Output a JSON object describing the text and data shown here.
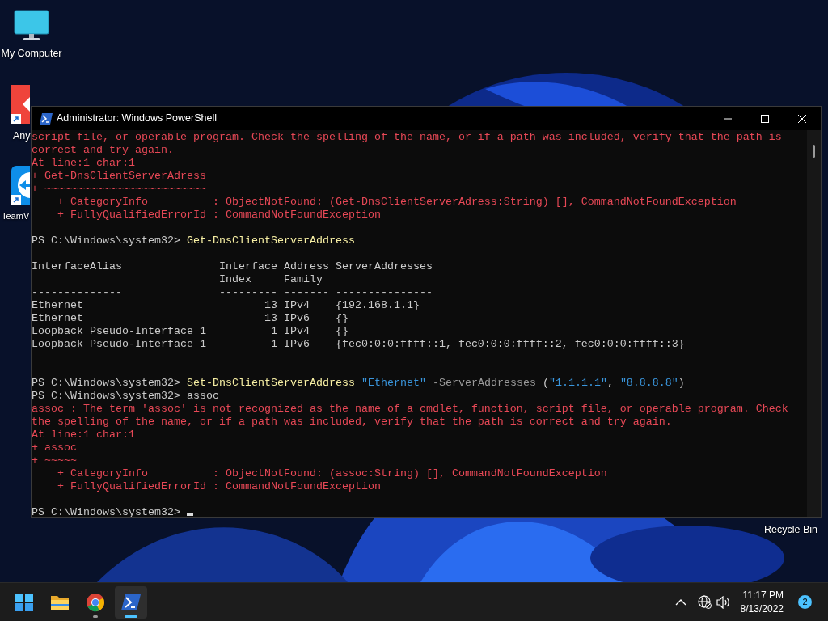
{
  "desktop_icons": [
    {
      "label": "My Computer",
      "kind": "computer",
      "shortcut": false
    },
    {
      "label": "Any",
      "kind": "anydesk",
      "shortcut": true
    },
    {
      "label": "TeamV",
      "kind": "teamviewer",
      "shortcut": true
    }
  ],
  "recycle_bin": {
    "label": "Recycle Bin"
  },
  "window": {
    "title": "Administrator: Windows PowerShell",
    "lines": [
      {
        "kind": "text",
        "segments": [
          {
            "kind": "error",
            "text": "script file, or operable program. Check the spelling of the name, or if a path was included, verify that the path is"
          }
        ]
      },
      {
        "kind": "text",
        "segments": [
          {
            "kind": "error",
            "text": "correct and try again."
          }
        ]
      },
      {
        "kind": "text",
        "segments": [
          {
            "kind": "error",
            "text": "At line:1 char:1"
          }
        ]
      },
      {
        "kind": "text",
        "segments": [
          {
            "kind": "error",
            "text": "+ Get-DnsClientServerAdress"
          }
        ]
      },
      {
        "kind": "text",
        "segments": [
          {
            "kind": "error",
            "text": "+ ~~~~~~~~~~~~~~~~~~~~~~~~~"
          }
        ]
      },
      {
        "kind": "text",
        "segments": [
          {
            "kind": "error",
            "text": "    + CategoryInfo          : ObjectNotFound: (Get-DnsClientServerAdress:String) [], CommandNotFoundException"
          }
        ]
      },
      {
        "kind": "text",
        "segments": [
          {
            "kind": "error",
            "text": "    + FullyQualifiedErrorId : CommandNotFoundException"
          }
        ]
      },
      {
        "kind": "blank"
      },
      {
        "kind": "text",
        "segments": [
          {
            "kind": "prompt",
            "text": "PS C:\\Windows\\system32> "
          },
          {
            "kind": "command",
            "text": "Get-DnsClientServerAddress"
          }
        ]
      },
      {
        "kind": "blank"
      },
      {
        "kind": "text",
        "segments": [
          {
            "kind": "output",
            "text": "InterfaceAlias               Interface Address ServerAddresses"
          }
        ]
      },
      {
        "kind": "text",
        "segments": [
          {
            "kind": "output",
            "text": "                             Index     Family"
          }
        ]
      },
      {
        "kind": "text",
        "segments": [
          {
            "kind": "output",
            "text": "--------------               --------- ------- ---------------"
          }
        ]
      },
      {
        "kind": "text",
        "segments": [
          {
            "kind": "output",
            "text": "Ethernet                            13 IPv4    {192.168.1.1}"
          }
        ]
      },
      {
        "kind": "text",
        "segments": [
          {
            "kind": "output",
            "text": "Ethernet                            13 IPv6    {}"
          }
        ]
      },
      {
        "kind": "text",
        "segments": [
          {
            "kind": "output",
            "text": "Loopback Pseudo-Interface 1          1 IPv4    {}"
          }
        ]
      },
      {
        "kind": "text",
        "segments": [
          {
            "kind": "output",
            "text": "Loopback Pseudo-Interface 1          1 IPv6    {fec0:0:0:ffff::1, fec0:0:0:ffff::2, fec0:0:0:ffff::3}"
          }
        ]
      },
      {
        "kind": "blank"
      },
      {
        "kind": "blank"
      },
      {
        "kind": "text",
        "segments": [
          {
            "kind": "prompt",
            "text": "PS C:\\Windows\\system32> "
          },
          {
            "kind": "command",
            "text": "Set-DnsClientServerAddress"
          },
          {
            "kind": "string",
            "text": " \"Ethernet\""
          },
          {
            "kind": "parameter",
            "text": " -ServerAddresses"
          },
          {
            "kind": "output",
            "text": " ("
          },
          {
            "kind": "string",
            "text": "\"1.1.1.1\""
          },
          {
            "kind": "output",
            "text": ", "
          },
          {
            "kind": "string",
            "text": "\"8.8.8.8\""
          },
          {
            "kind": "output",
            "text": ")"
          }
        ]
      },
      {
        "kind": "text",
        "segments": [
          {
            "kind": "prompt",
            "text": "PS C:\\Windows\\system32> "
          },
          {
            "kind": "output",
            "text": "assoc"
          }
        ]
      },
      {
        "kind": "text",
        "segments": [
          {
            "kind": "error",
            "text": "assoc : The term 'assoc' is not recognized as the name of a cmdlet, function, script file, or operable program. Check"
          }
        ]
      },
      {
        "kind": "text",
        "segments": [
          {
            "kind": "error",
            "text": "the spelling of the name, or if a path was included, verify that the path is correct and try again."
          }
        ]
      },
      {
        "kind": "text",
        "segments": [
          {
            "kind": "error",
            "text": "At line:1 char:1"
          }
        ]
      },
      {
        "kind": "text",
        "segments": [
          {
            "kind": "error",
            "text": "+ assoc"
          }
        ]
      },
      {
        "kind": "text",
        "segments": [
          {
            "kind": "error",
            "text": "+ ~~~~~"
          }
        ]
      },
      {
        "kind": "text",
        "segments": [
          {
            "kind": "error",
            "text": "    + CategoryInfo          : ObjectNotFound: (assoc:String) [], CommandNotFoundException"
          }
        ]
      },
      {
        "kind": "text",
        "segments": [
          {
            "kind": "error",
            "text": "    + FullyQualifiedErrorId : CommandNotFoundException"
          }
        ]
      },
      {
        "kind": "blank"
      },
      {
        "kind": "text",
        "segments": [
          {
            "kind": "prompt",
            "text": "PS C:\\Windows\\system32> "
          }
        ]
      }
    ]
  },
  "taskbar": {
    "apps": [
      {
        "kind": "start",
        "running": false,
        "selected": false
      },
      {
        "kind": "explorer",
        "running": false,
        "selected": false
      },
      {
        "kind": "chrome",
        "running": true,
        "selected": false
      },
      {
        "kind": "powershell",
        "running": true,
        "selected": true
      }
    ],
    "time": "11:17 PM",
    "date": "8/13/2022",
    "notifications": "2"
  }
}
